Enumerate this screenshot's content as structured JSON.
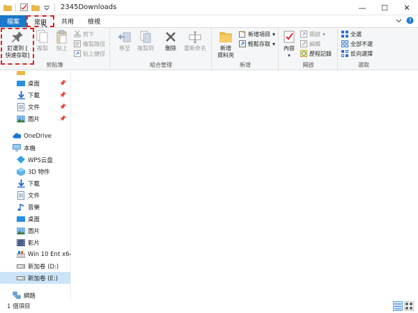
{
  "window": {
    "title": "2345Downloads",
    "controls": {
      "minimize": "—",
      "maximize": "☐",
      "close": "✕"
    }
  },
  "ribbon_tabs": [
    {
      "label": "檔案"
    },
    {
      "label": "常用"
    },
    {
      "label": "共用"
    },
    {
      "label": "檢視"
    }
  ],
  "clipboard": {
    "group": "剪貼簿",
    "pin_quick_access": "釘選到 [\n快速存取]",
    "copy": "複製",
    "paste": "貼上",
    "cut": "剪下",
    "copy_path": "複製路徑",
    "paste_shortcut": "貼上捷徑"
  },
  "organize": {
    "group": "組合管理",
    "move_to": "移至",
    "copy_to": "複製到",
    "delete": "刪除",
    "rename": "重新命名"
  },
  "new_group": {
    "group": "新增",
    "new_folder": "新增\n資料夾",
    "new_item": "新增項目",
    "easy_access": "輕鬆存取"
  },
  "open_group": {
    "group": "開啟",
    "properties": "內容",
    "open": "開啟",
    "edit": "編輯",
    "history": "歷程記錄"
  },
  "select_group": {
    "group": "選取",
    "select_all": "全選",
    "select_none": "全部不選",
    "invert": "反向選擇"
  },
  "nav": {
    "quick_items": [
      {
        "label": "桌面",
        "icon": "desktop-icon"
      },
      {
        "label": "下載",
        "icon": "download-icon"
      },
      {
        "label": "文件",
        "icon": "document-icon"
      },
      {
        "label": "圖片",
        "icon": "picture-icon"
      }
    ],
    "onedrive": "OneDrive",
    "this_pc": "本機",
    "pc_items": [
      {
        "label": "WPS云盘",
        "icon": "cloud-icon"
      },
      {
        "label": "3D 物件",
        "icon": "3d-objects-icon"
      },
      {
        "label": "下載",
        "icon": "download-icon"
      },
      {
        "label": "文件",
        "icon": "document-icon"
      },
      {
        "label": "音樂",
        "icon": "music-icon"
      },
      {
        "label": "桌面",
        "icon": "desktop-icon"
      },
      {
        "label": "圖片",
        "icon": "picture-icon"
      },
      {
        "label": "影片",
        "icon": "video-icon"
      },
      {
        "label": "Win 10 Ent x64",
        "icon": "drive-icon"
      },
      {
        "label": "新加卷 (D:)",
        "icon": "drive-icon"
      },
      {
        "label": "新加卷 (E:)",
        "icon": "drive-icon"
      }
    ],
    "network": "網路"
  },
  "status": {
    "item_count": "1 個項目"
  },
  "colors": {
    "accent": "#1979ca",
    "selection": "#cce4f7",
    "highlight": "#e02020"
  }
}
